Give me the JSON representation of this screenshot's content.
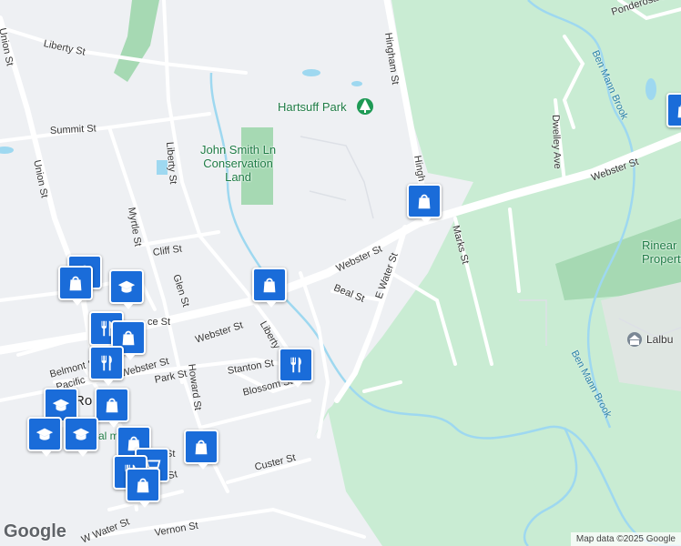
{
  "streets": [
    {
      "id": "union-st-1",
      "label": "Union St"
    },
    {
      "id": "union-st-2",
      "label": "Union St"
    },
    {
      "id": "liberty-st-top",
      "label": "Liberty St"
    },
    {
      "id": "summit-st",
      "label": "Summit St"
    },
    {
      "id": "liberty-st-v",
      "label": "Liberty St"
    },
    {
      "id": "myrtle-st",
      "label": "Myrtle St"
    },
    {
      "id": "cliff-st",
      "label": "Cliff St"
    },
    {
      "id": "glen-st",
      "label": "Glen St"
    },
    {
      "id": "webster-st-1",
      "label": "Webster St"
    },
    {
      "id": "webster-st-2",
      "label": "Webster St"
    },
    {
      "id": "webster-st-3",
      "label": "Webster St"
    },
    {
      "id": "webster-st-4",
      "label": "Webster St"
    },
    {
      "id": "liberty-st-low",
      "label": "Liberty"
    },
    {
      "id": "belmont-st",
      "label": "Belmont St"
    },
    {
      "id": "pacific-st",
      "label": "Pacific"
    },
    {
      "id": "howard-st",
      "label": "Howard St"
    },
    {
      "id": "park-st",
      "label": "Park St"
    },
    {
      "id": "stanton-st",
      "label": "Stanton St"
    },
    {
      "id": "blossom-st",
      "label": "Blossom St"
    },
    {
      "id": "beal-st",
      "label": "Beal St"
    },
    {
      "id": "e-water-st",
      "label": "E Water St"
    },
    {
      "id": "hingham-st",
      "label": "Hingham St"
    },
    {
      "id": "hingham-st-2",
      "label": "Hingh"
    },
    {
      "id": "marks-st",
      "label": "Marks St"
    },
    {
      "id": "dwelley-ave",
      "label": "Dwelley Ave"
    },
    {
      "id": "ponderosa-dr",
      "label": "Ponderosa Dr"
    },
    {
      "id": "custer-st",
      "label": "Custer St"
    },
    {
      "id": "vernon-st",
      "label": "Vernon St"
    },
    {
      "id": "w-water-st",
      "label": "W Water St"
    },
    {
      "id": "fragment-ce-st",
      "label": "ce St"
    },
    {
      "id": "fragment-st",
      "label": "St"
    },
    {
      "id": "fragment-ur-st",
      "label": "ur St"
    },
    {
      "id": "fragment-un",
      "label": "Un"
    }
  ],
  "parks": {
    "hartsuff": "Hartsuff Park",
    "john_smith": "John Smith Ln\nConservation\nLand",
    "rinear": "Rinear\nProperty",
    "lalbu": "Lalbu"
  },
  "water": {
    "ben_mann_1": "Ben Mann Brook",
    "ben_mann_2": "Ben Mann Brook"
  },
  "town": {
    "rockland": "Ro     nd",
    "hall": "al    m"
  },
  "attribution": "Map data ©2025 Google",
  "logo": "Google",
  "colors": {
    "land": "#eef0f3",
    "park": "#c9ecd3",
    "park_dark": "#a6d9b3",
    "water": "#9ed8f0",
    "road": "#ffffff",
    "pin": "#1a6cd9"
  },
  "pins": [
    {
      "icon": "shopping-bag-icon"
    },
    {
      "icon": "shopping-bag-icon"
    },
    {
      "icon": "graduation-cap-icon"
    },
    {
      "icon": "fork-knife-icon"
    },
    {
      "icon": "shopping-bag-icon"
    },
    {
      "icon": "fork-knife-icon"
    },
    {
      "icon": "shopping-bag-icon"
    },
    {
      "icon": "graduation-cap-icon"
    },
    {
      "icon": "graduation-cap-icon"
    },
    {
      "icon": "graduation-cap-icon"
    },
    {
      "icon": "shopping-bag-icon"
    },
    {
      "icon": "shopping-bag-icon"
    },
    {
      "icon": "shopping-cart-icon"
    },
    {
      "icon": "fork-knife-icon"
    },
    {
      "icon": "shopping-bag-icon"
    },
    {
      "icon": "shopping-bag-icon"
    },
    {
      "icon": "fork-knife-icon"
    },
    {
      "icon": "shopping-bag-icon"
    },
    {
      "icon": "fork-knife-icon"
    }
  ]
}
